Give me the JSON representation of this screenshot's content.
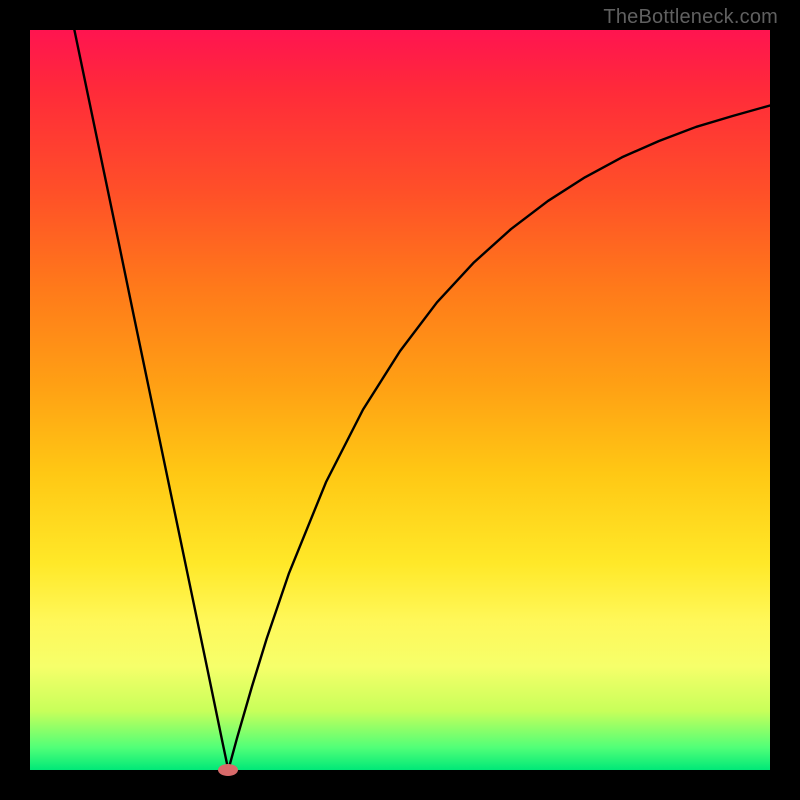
{
  "attribution": "TheBottleneck.com",
  "chart_data": {
    "type": "line",
    "title": "",
    "xlabel": "",
    "ylabel": "",
    "xlim": [
      0,
      100
    ],
    "ylim": [
      0,
      100
    ],
    "grid": false,
    "background": "vertical red→yellow→green gradient",
    "series": [
      {
        "name": "curve",
        "x": [
          6,
          8,
          10,
          12,
          14,
          16,
          18,
          20,
          22,
          24,
          26,
          26.8,
          28,
          30,
          32,
          35,
          40,
          45,
          50,
          55,
          60,
          65,
          70,
          75,
          80,
          85,
          90,
          95,
          100
        ],
        "y": [
          100,
          90.4,
          80.8,
          71.2,
          61.5,
          51.9,
          42.3,
          32.7,
          23.1,
          13.5,
          3.8,
          0,
          4.4,
          11.3,
          17.8,
          26.6,
          38.9,
          48.7,
          56.6,
          63.2,
          68.6,
          73.1,
          76.9,
          80.1,
          82.8,
          85.0,
          86.9,
          88.4,
          89.8
        ]
      }
    ],
    "marker": {
      "x": 26.8,
      "y": 0,
      "color": "#d86a6a"
    }
  }
}
